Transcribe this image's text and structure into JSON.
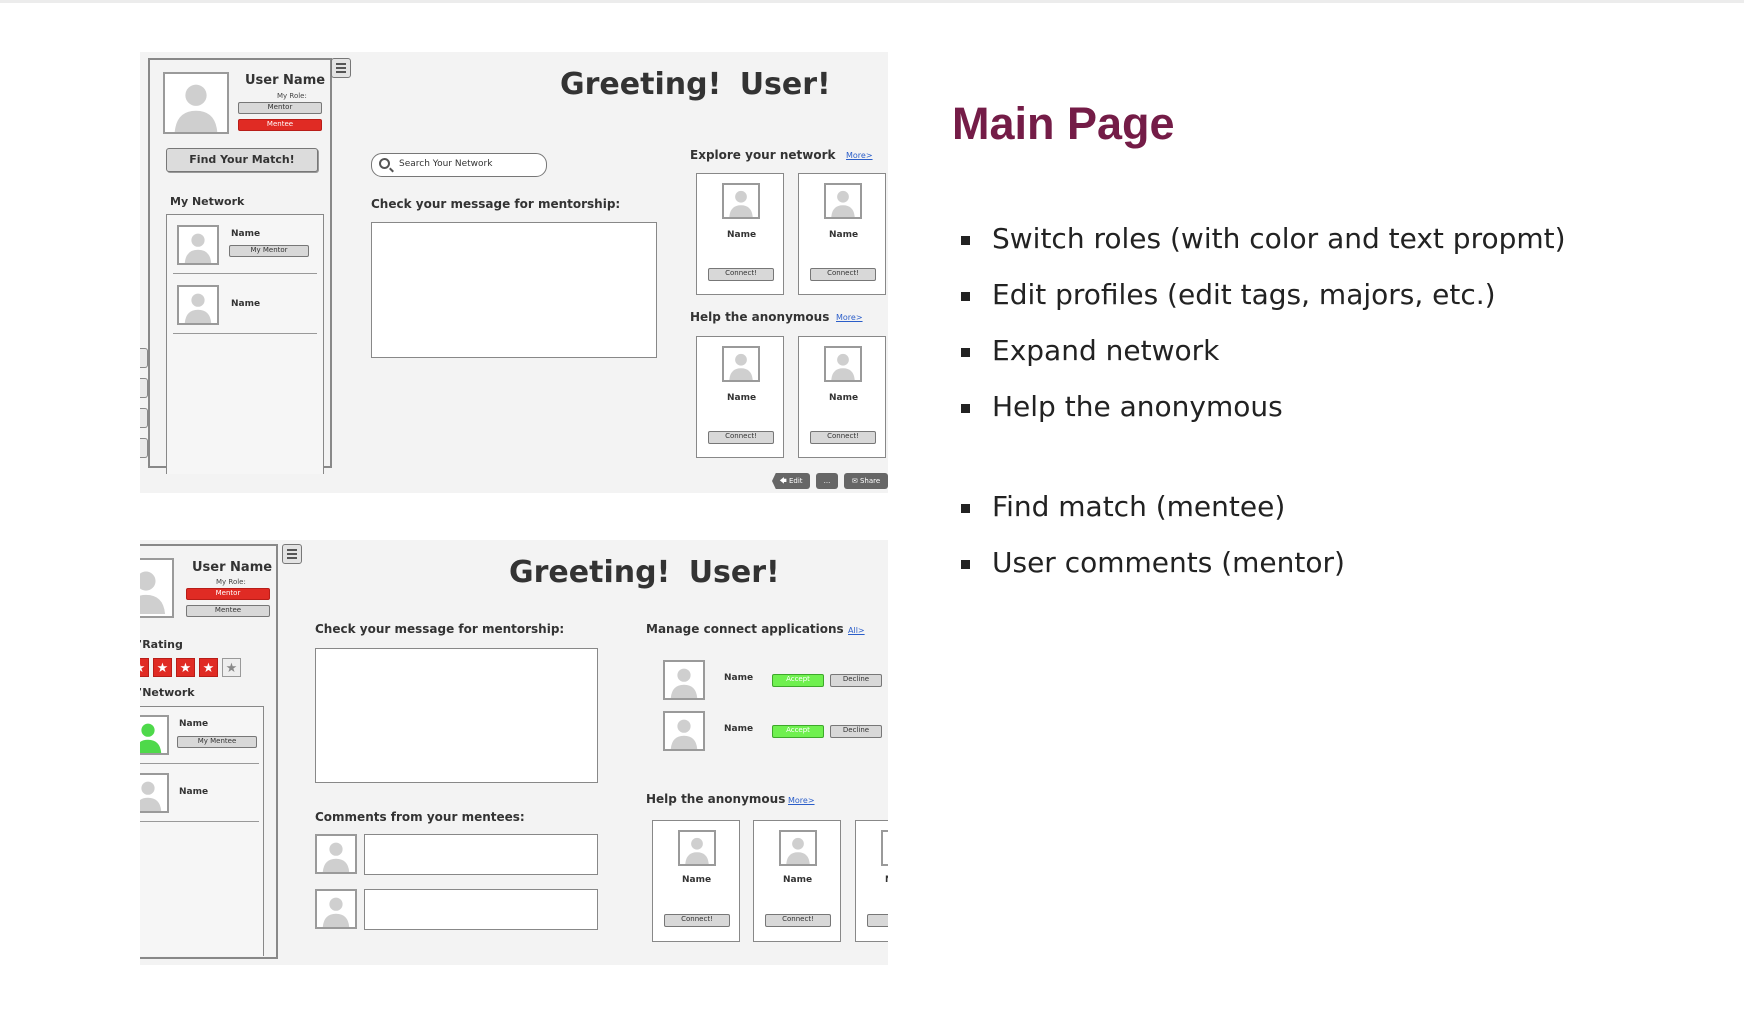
{
  "right_panel": {
    "title": "Main Page",
    "bullets": [
      "Switch roles (with color and text propmt)",
      "Edit profiles (edit tags, majors, etc.)",
      "Expand network",
      "Help the anonymous",
      "Find match (mentee)",
      "User comments (mentor)"
    ]
  },
  "mockup_mentee": {
    "user_name": "User Name",
    "role_label": "My Role:",
    "role_buttons": [
      "Mentor",
      "Mentee"
    ],
    "active_role": "Mentee",
    "find_match_button": "Find Your Match!",
    "my_network_label": "My Network",
    "network": [
      {
        "name": "Name",
        "tag": "My Mentor"
      },
      {
        "name": "Name",
        "tag": ""
      }
    ],
    "greeting": "Greeting!  User!",
    "search_placeholder": "Search Your Network",
    "message_label": "Check your message for mentorship:",
    "explore_label": "Explore your network",
    "explore_link": "More>",
    "explore_cards": [
      {
        "name": "Name",
        "button": "Connect!"
      },
      {
        "name": "Name",
        "button": "Connect!"
      }
    ],
    "anonymous_label": "Help the anonymous",
    "anonymous_link": "More>",
    "anonymous_cards": [
      {
        "name": "Name",
        "button": "Connect!"
      },
      {
        "name": "Name",
        "button": "Connect!"
      }
    ],
    "footer_buttons": [
      "Edit",
      "...",
      "Share"
    ]
  },
  "mockup_mentor": {
    "user_name": "User Name",
    "role_label": "My Role:",
    "role_buttons": [
      "Mentor",
      "Mentee"
    ],
    "active_role": "Mentor",
    "rating_label": "Rating",
    "rating": 4,
    "rating_max": 5,
    "my_network_label": "Network",
    "network": [
      {
        "name": "Name",
        "tag": "My Mentee"
      },
      {
        "name": "Name",
        "tag": ""
      }
    ],
    "greeting": "Greeting!  User!",
    "message_label": "Check your message for mentorship:",
    "comments_label": "Comments from your mentees:",
    "manage_label": "Manage connect applications",
    "manage_link": "All>",
    "applications": [
      {
        "name": "Name",
        "accept": "Accept",
        "decline": "Decline"
      },
      {
        "name": "Name",
        "accept": "Accept",
        "decline": "Decline"
      }
    ],
    "anonymous_label": "Help the anonymous",
    "anonymous_link": "More>",
    "anonymous_cards": [
      {
        "name": "Name",
        "button": "Connect!"
      },
      {
        "name": "Name",
        "button": "Connect!"
      },
      {
        "name": "N",
        "button": "C"
      }
    ]
  },
  "colors": {
    "title": "#741c47",
    "active_role": "#e02b24",
    "accept": "#6ff04f",
    "avatar_highlight": "#4ed94a",
    "link": "#2b5ec9",
    "panel_bg": "#f3f3f3"
  }
}
